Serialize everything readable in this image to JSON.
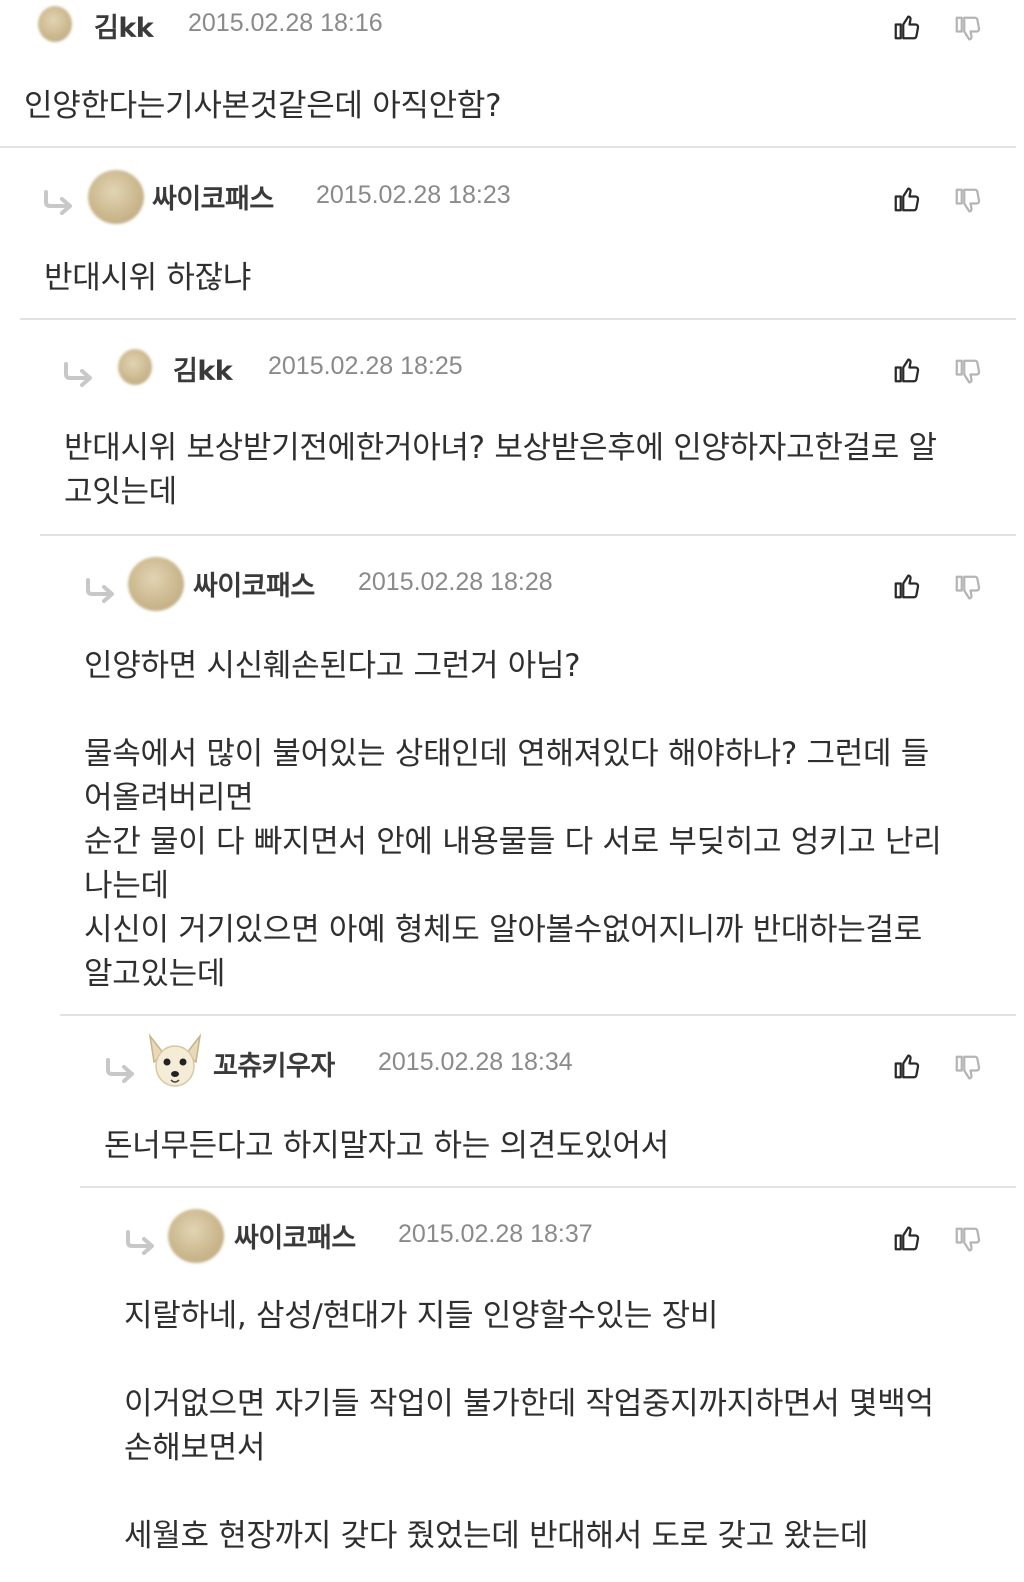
{
  "comments": [
    {
      "author": "김kk",
      "time": "2015.02.28 18:16",
      "text": "인양한다는기사본것같은데 아직안함?",
      "avatar": "beige"
    },
    {
      "author": "싸이코패스",
      "time": "2015.02.28 18:23",
      "text": "반대시위 하잖냐",
      "avatar": "beige"
    },
    {
      "author": "김kk",
      "time": "2015.02.28 18:25",
      "text": "반대시위 보상받기전에한거아녀? 보상받은후에 인양하자고한걸로 알\n고잇는데",
      "avatar": "beige"
    },
    {
      "author": "싸이코패스",
      "time": "2015.02.28 18:28",
      "text": "인양하면 시신훼손된다고 그런거 아님?\n\n물속에서 많이 불어있는 상태인데 연해져있다 해야하나? 그런데 들\n어올려버리면\n순간 물이 다 빠지면서 안에 내용물들 다 서로 부딪히고 엉키고 난리\n나는데\n시신이 거기있으면 아예 형체도 알아볼수없어지니까 반대하는걸로\n알고있는데",
      "avatar": "beige"
    },
    {
      "author": "꼬츄키우자",
      "time": "2015.02.28 18:34",
      "text": "돈너무든다고 하지말자고 하는 의견도있어서",
      "avatar": "dog"
    },
    {
      "author": "싸이코패스",
      "time": "2015.02.28 18:37",
      "text": "지랄하네, 삼성/현대가 지들 인양할수있는 장비\n\n이거없으면 자기들 작업이 불가한데 작업중지까지하면서 몇백억\n손해보면서\n\n세월호 현장까지 갖다 줬었는데 반대해서 도로 갖고 왔는데",
      "avatar": "beige"
    }
  ],
  "icons": {
    "like": "thumbs-up-icon",
    "dislike": "thumbs-down-icon",
    "reply": "reply-arrow-icon"
  },
  "colors": {
    "text": "#2f2f2f",
    "meta": "#8a8a8a",
    "divider": "#e2e2e2"
  }
}
